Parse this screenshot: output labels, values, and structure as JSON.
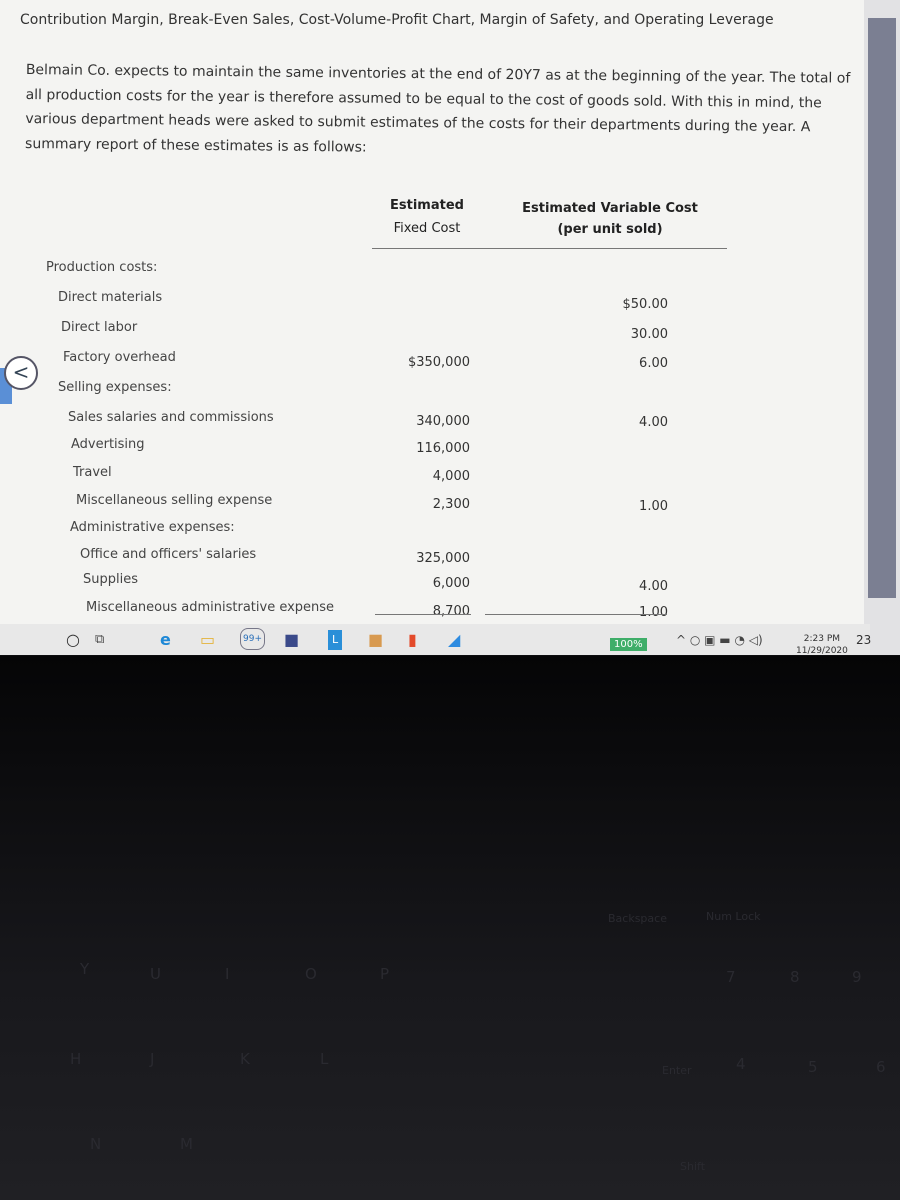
{
  "title": "Contribution Margin, Break-Even Sales, Cost-Volume-Profit Chart, Margin of Safety, and Operating Leverage",
  "intro": "Belmain Co. expects to maintain the same inventories at the end of 20Y7 as at the beginning of the year. The total of all production costs for the year is therefore assumed to be equal to the cost of goods sold. With this in mind, the various department heads were asked to submit estimates of the costs for their departments during the year. A summary report of these estimates is as follows:",
  "table": {
    "col1": [
      "Estimated",
      "Fixed Cost"
    ],
    "col2": [
      "Estimated Variable Cost",
      "(per unit sold)"
    ],
    "rows": [
      {
        "label": "Production costs:",
        "fixed": "",
        "variable": ""
      },
      {
        "label": "Direct materials",
        "fixed": "",
        "variable": "$50.00"
      },
      {
        "label": "Direct labor",
        "fixed": "",
        "variable": "30.00"
      },
      {
        "label": "Factory overhead",
        "fixed": "$350,000",
        "variable": "6.00"
      },
      {
        "label": "Selling expenses:",
        "fixed": "",
        "variable": ""
      },
      {
        "label": "Sales salaries and commissions",
        "fixed": "340,000",
        "variable": "4.00"
      },
      {
        "label": "Advertising",
        "fixed": "116,000",
        "variable": ""
      },
      {
        "label": "Travel",
        "fixed": "4,000",
        "variable": ""
      },
      {
        "label": "Miscellaneous selling expense",
        "fixed": "2,300",
        "variable": "1.00"
      },
      {
        "label": "Administrative expenses:",
        "fixed": "",
        "variable": ""
      },
      {
        "label": "Office and officers' salaries",
        "fixed": "325,000",
        "variable": ""
      },
      {
        "label": "Supplies",
        "fixed": "6,000",
        "variable": "4.00"
      },
      {
        "label": "Miscellaneous administrative expense",
        "fixed": "8,700",
        "variable": "1.00"
      }
    ]
  },
  "nav": {
    "back_icon": "<"
  },
  "taskbar": {
    "icons": [
      "search-circle",
      "task-view",
      "edge",
      "file-explorer",
      "mail",
      "store",
      "app-l",
      "app-orange",
      "office",
      "photos"
    ],
    "mail_badge": "99+",
    "zoom": "100%",
    "time": "2:23 PM",
    "date": "11/29/2020",
    "notifications": "23"
  },
  "keyboard": {
    "keys": [
      "Backspace",
      "Num Lock",
      "Enter",
      "Shift",
      "Y",
      "U",
      "I",
      "O",
      "P",
      "H",
      "J",
      "K",
      "L",
      "N",
      "M",
      "7",
      "8",
      "9",
      "4",
      "5",
      "6"
    ]
  }
}
